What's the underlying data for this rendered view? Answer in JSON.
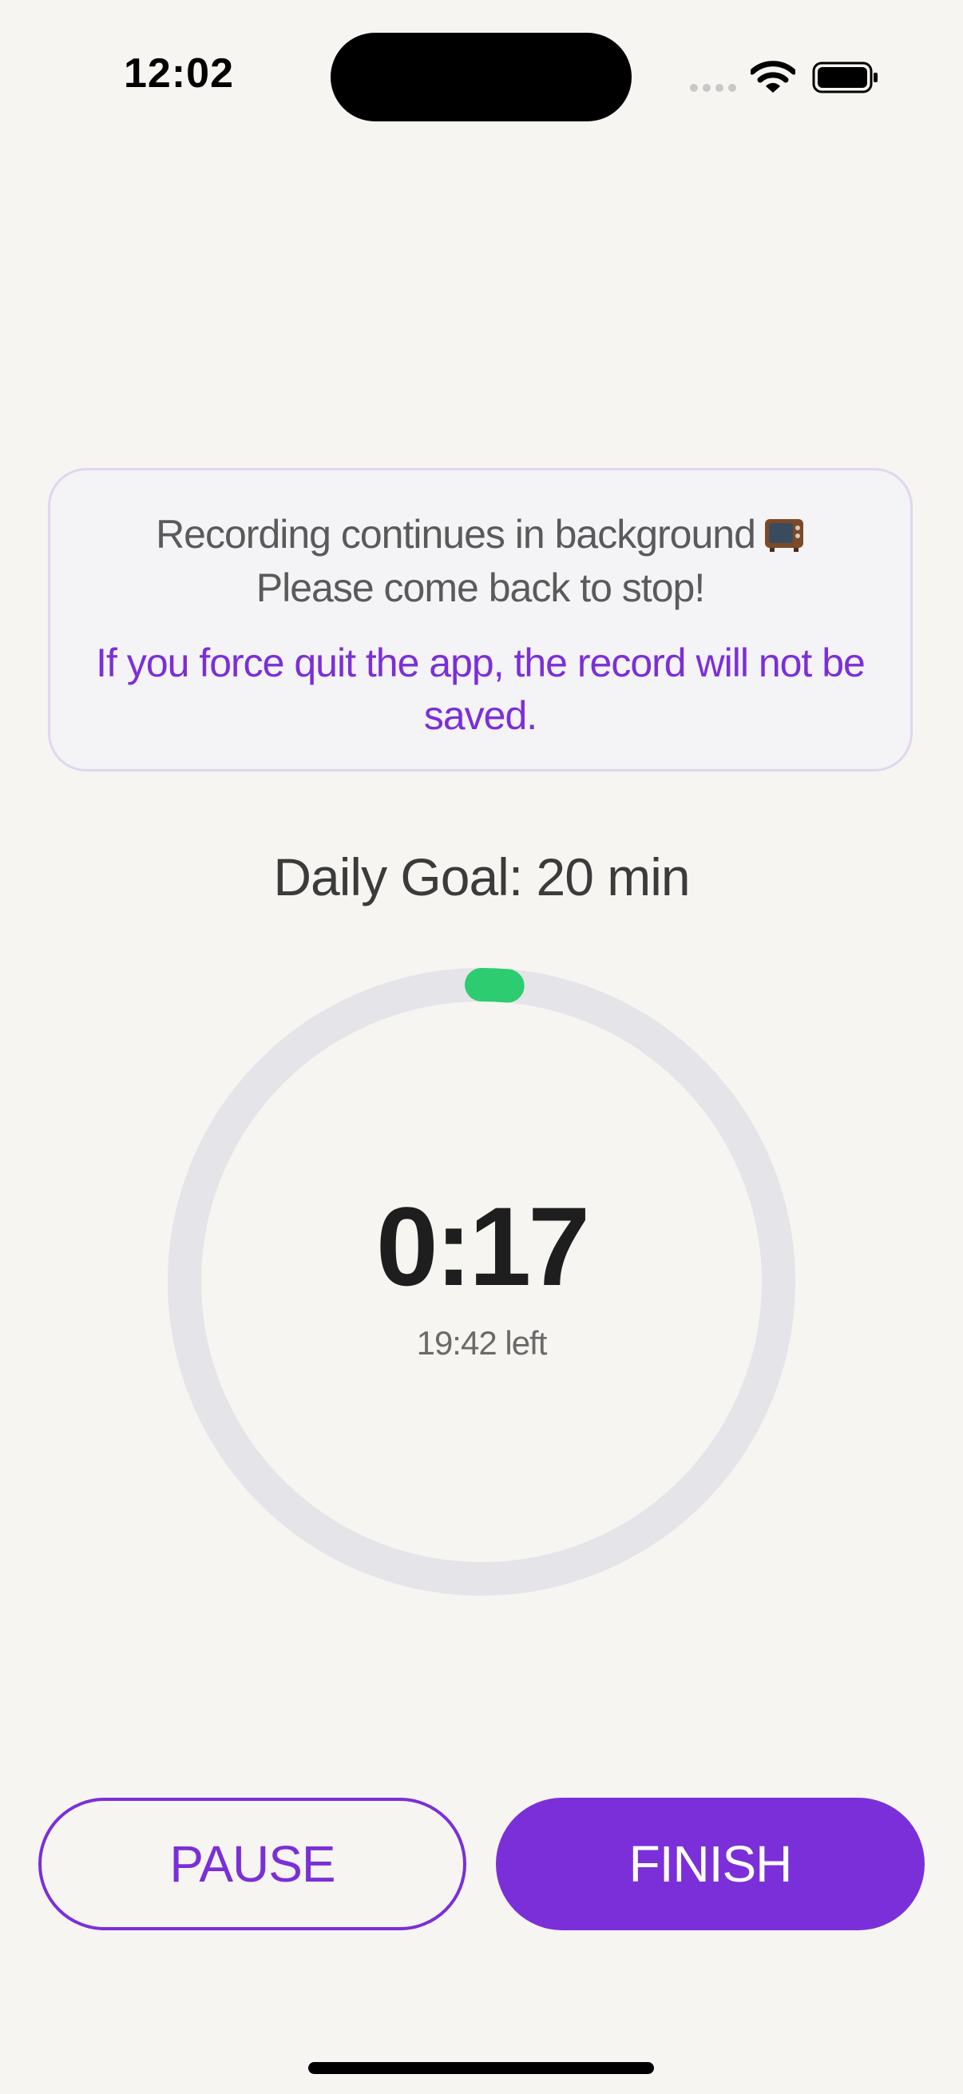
{
  "status_bar": {
    "time": "12:02",
    "icons": [
      "cellular-signal-icon",
      "wifi-icon",
      "battery-icon"
    ]
  },
  "notice": {
    "line1": "Recording continues in background",
    "line1_emoji": "television-icon",
    "line2": "Please come back to stop!",
    "warning": "If you force quit the app, the record will not be saved."
  },
  "goal": {
    "label": "Daily Goal: 20 min"
  },
  "timer": {
    "elapsed": "0:17",
    "remaining": "19:42 left",
    "progress_fraction": 0.014
  },
  "actions": {
    "pause_label": "PAUSE",
    "finish_label": "FINISH"
  },
  "colors": {
    "background": "#f6f5f1",
    "accent": "#7b2fd8",
    "progress": "#2ecc71",
    "ring_track": "#e5e4e8"
  }
}
